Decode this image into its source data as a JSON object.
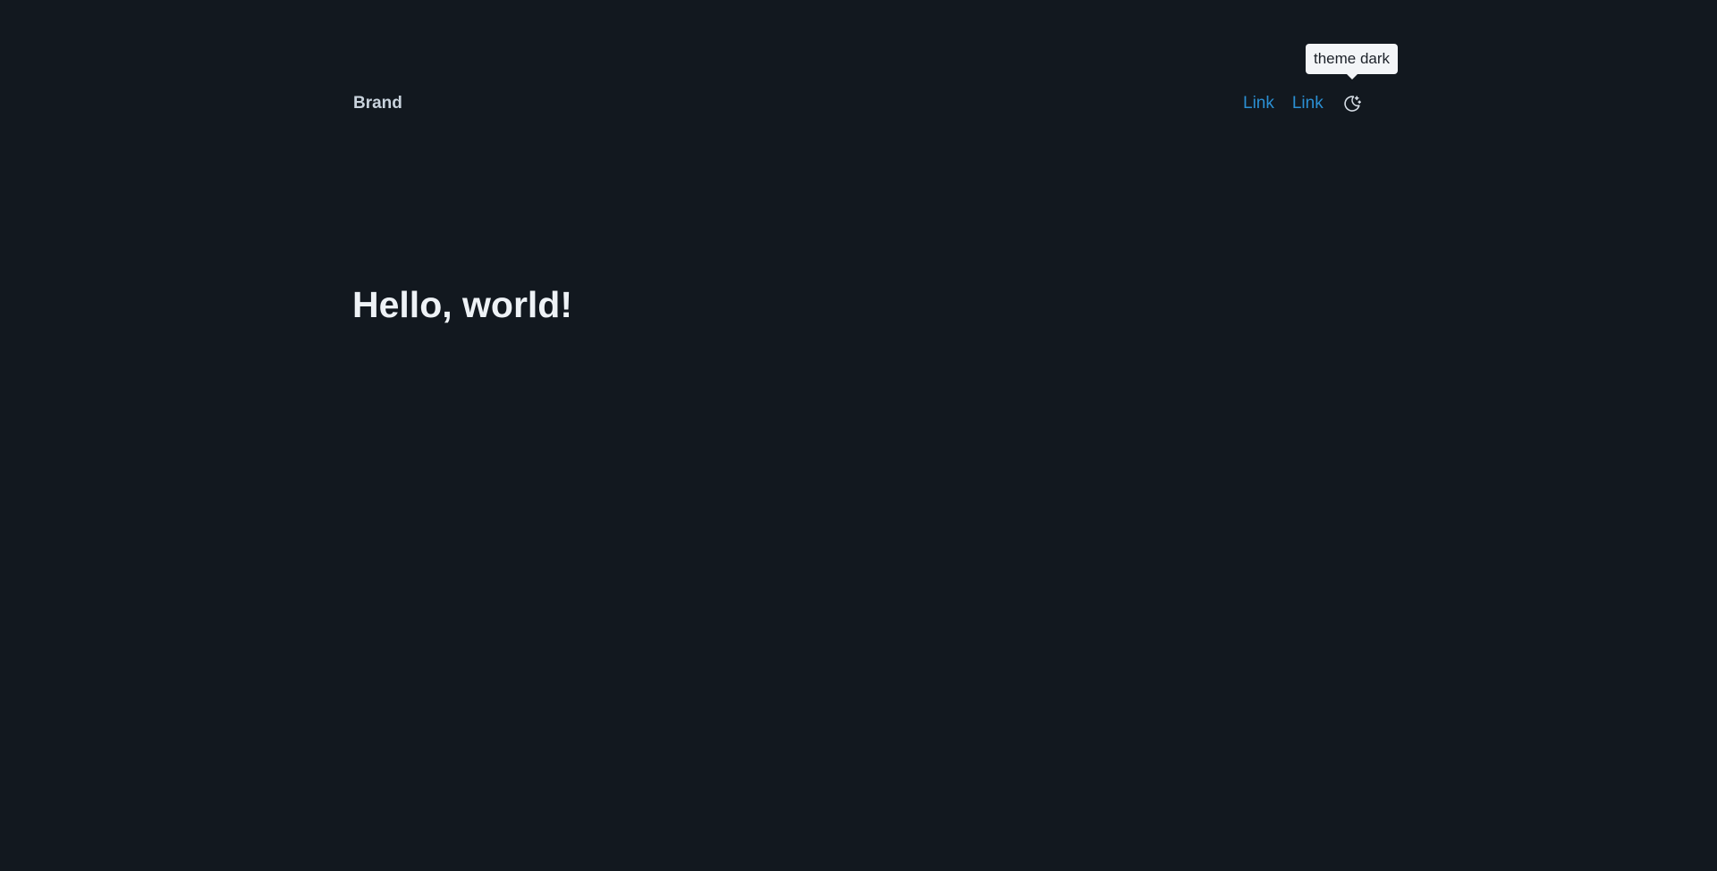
{
  "navbar": {
    "brand": "Brand",
    "links": [
      {
        "label": "Link"
      },
      {
        "label": "Link"
      }
    ],
    "theme_toggle": {
      "icon": "moon-stars-icon",
      "tooltip": "theme dark"
    }
  },
  "main": {
    "heading": "Hello, world!"
  },
  "colors": {
    "background": "#12181f",
    "link": "#2b8fd3",
    "brand_text": "#c9d3dd",
    "heading_text": "#eef2f6",
    "tooltip_bg": "#f3f5f8"
  }
}
